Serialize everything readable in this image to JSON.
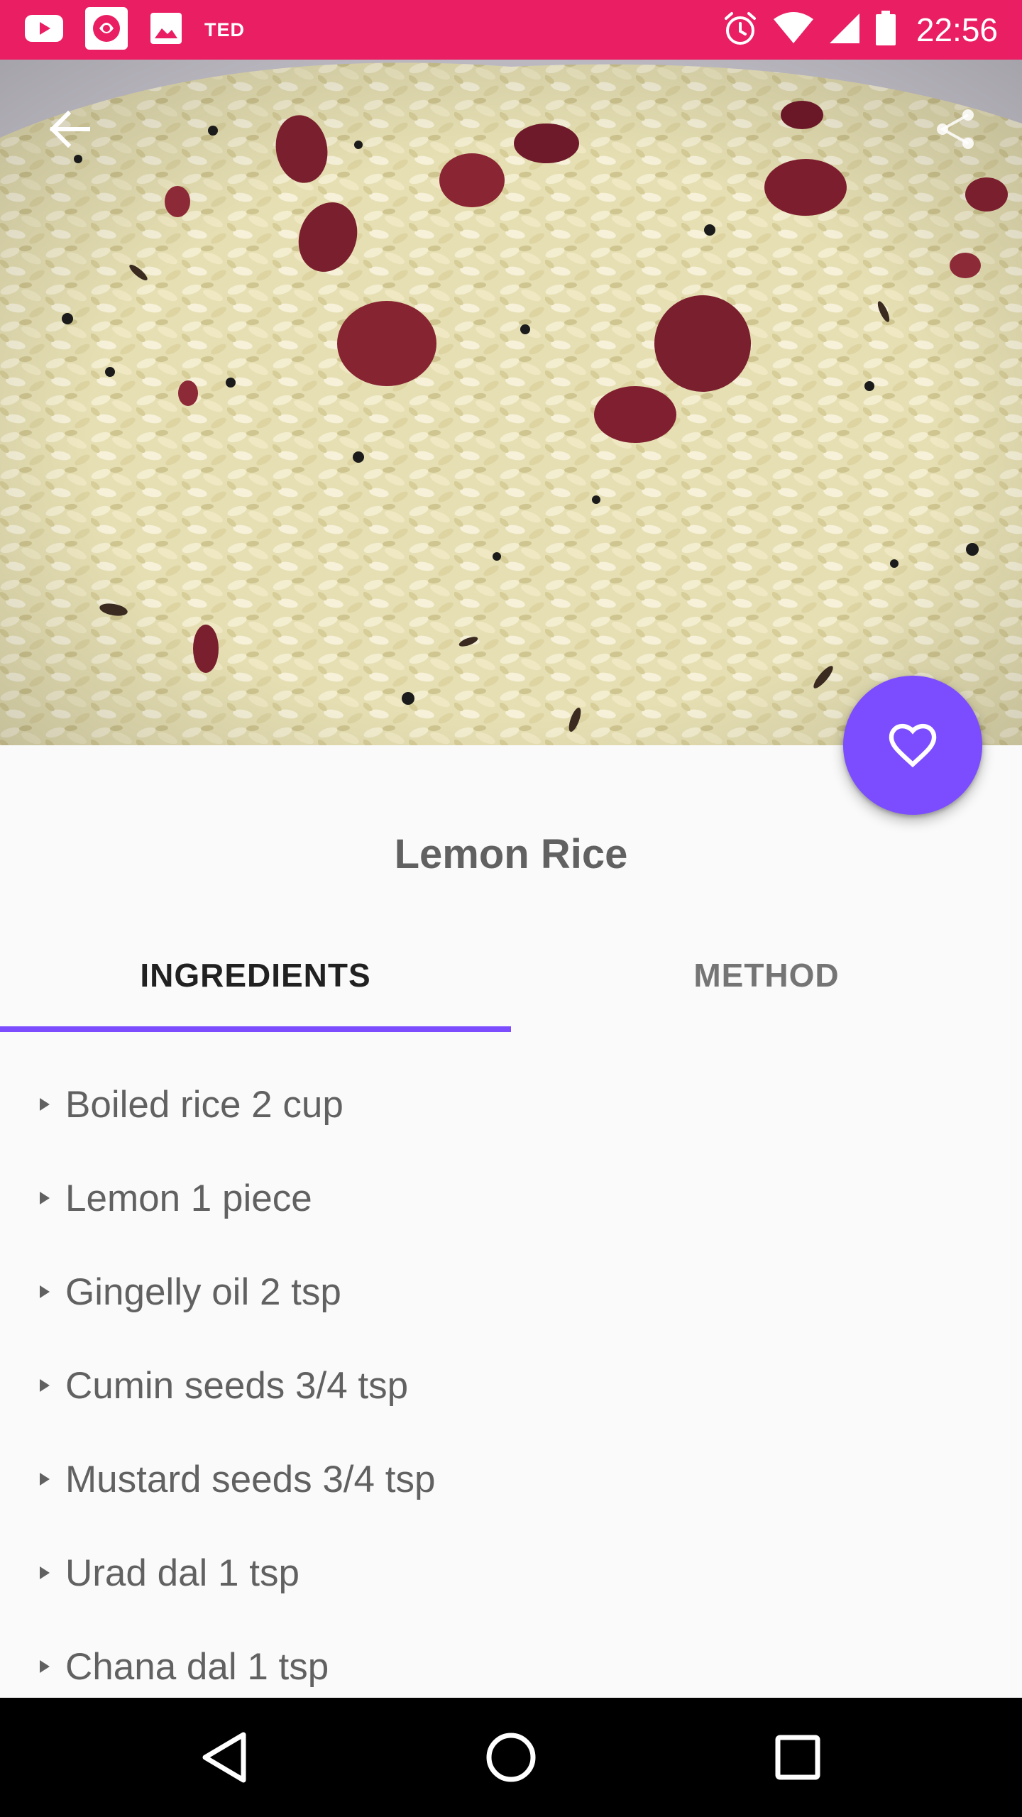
{
  "status_bar": {
    "background": "#e91e63",
    "time": "22:56",
    "ted_label": "TED",
    "notification_icons": [
      "youtube-icon",
      "app-icon",
      "image-icon",
      "ted-icon"
    ],
    "system_icons": [
      "alarm-icon",
      "wifi-icon",
      "signal-icon",
      "battery-icon"
    ]
  },
  "hero": {
    "back_icon": "arrow-back-icon",
    "share_icon": "share-icon"
  },
  "fab": {
    "icon": "heart-outline-icon",
    "color": "#7c4dff"
  },
  "recipe": {
    "title": "Lemon Rice"
  },
  "tabs": [
    {
      "label": "INGREDIENTS",
      "selected": true
    },
    {
      "label": "METHOD",
      "selected": false
    }
  ],
  "accent_color": "#7c4dff",
  "ingredients": [
    "Boiled rice 2 cup",
    "Lemon 1 piece",
    "Gingelly oil 2 tsp",
    "Cumin seeds 3/4 tsp",
    "Mustard seeds 3/4 tsp",
    "Urad dal 1 tsp",
    "Chana dal 1 tsp"
  ],
  "nav_bar": {
    "buttons": [
      "nav-back-icon",
      "nav-home-icon",
      "nav-recents-icon"
    ]
  }
}
